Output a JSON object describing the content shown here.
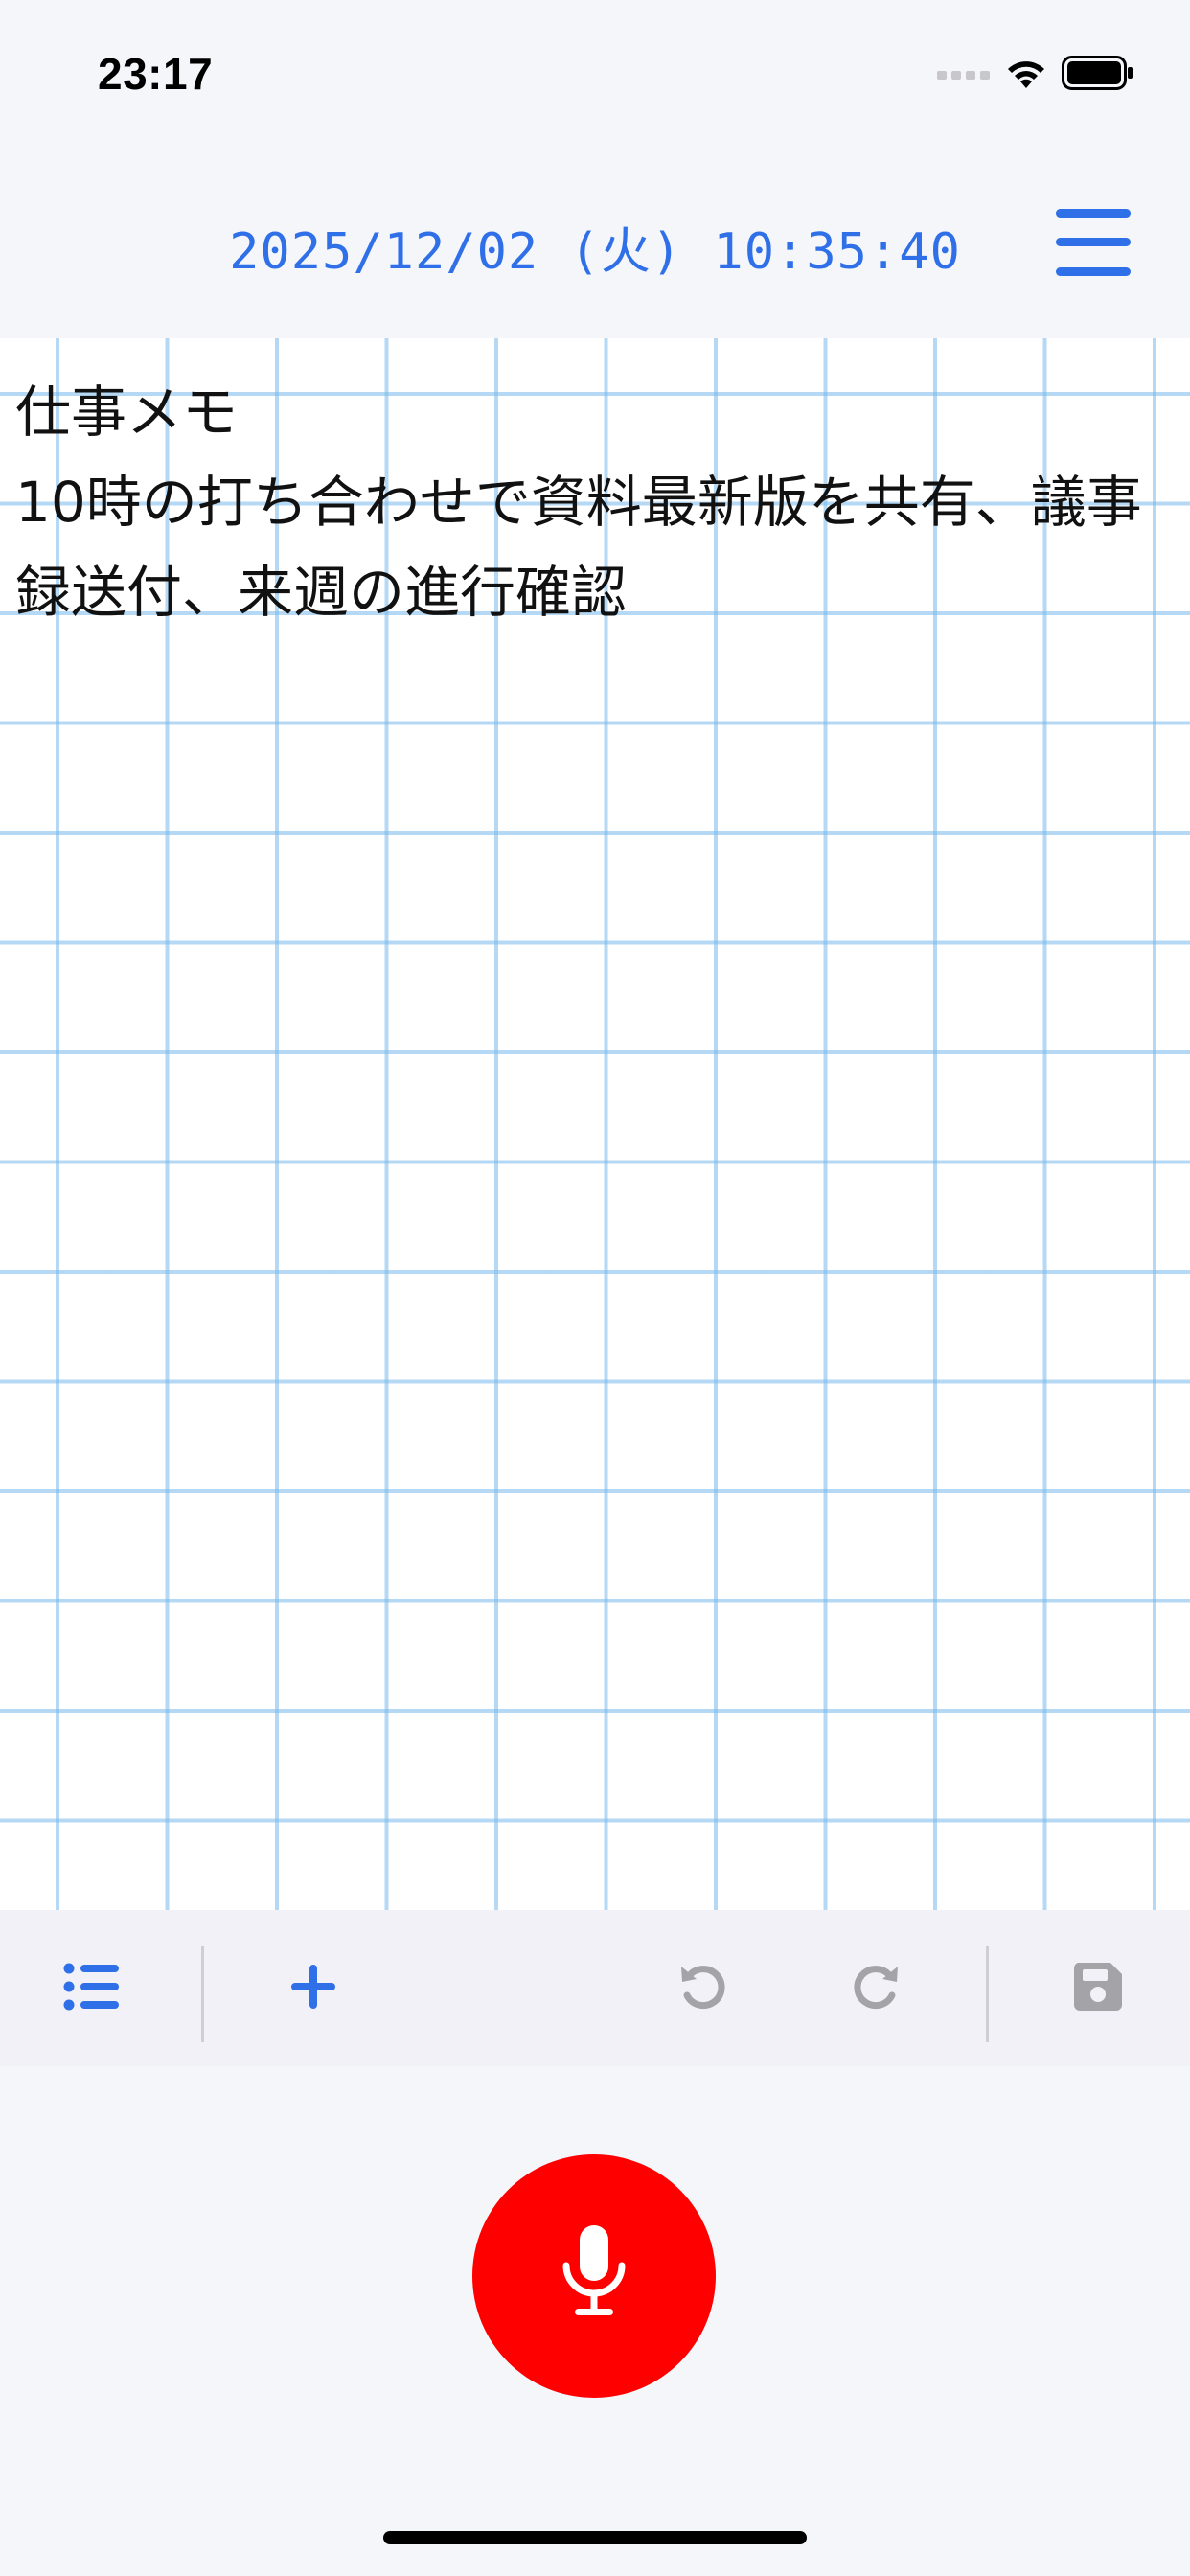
{
  "status_bar": {
    "time": "23:17"
  },
  "header": {
    "datetime": "2025/12/02 (火) 10:35:40"
  },
  "note": {
    "text": "仕事メモ\n10時の打ち合わせで資料最新版を共有、議事録送付、来週の進行確認"
  },
  "toolbar": {
    "icons": [
      "list-icon",
      "plus-icon",
      "undo-icon",
      "redo-icon",
      "save-icon"
    ]
  },
  "colors": {
    "accent": "#2f6fe8",
    "mic": "#ff0000",
    "disabled_icon": "#a3a3a8",
    "grid": "#78b9eb"
  }
}
